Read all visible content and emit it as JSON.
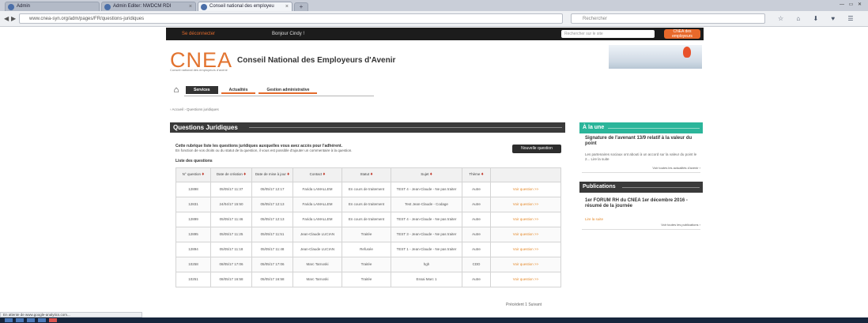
{
  "browser": {
    "tabs": [
      {
        "label": "Admin"
      },
      {
        "label": "Admin Editer: NWDCM RDI"
      },
      {
        "label": "Conseil national des employeu"
      }
    ],
    "new_tab": "+",
    "window_controls": "— ▭ ✕",
    "url": "www.cnea-syn.org/adm/pages/FR/questions-juridiques",
    "search_placeholder": "Rechercher",
    "back": "◀",
    "forward": "▶"
  },
  "site": {
    "top_left": "Se déconnecter",
    "greeting": "Bonjour Cindy !",
    "search_placeholder": "Rechercher sur le site",
    "top_logo": "CNEA des employeurs",
    "logo": "CNEA",
    "logo_sub": "Conseil national des employeurs d'avenir",
    "title": "Conseil National des Employeurs d'Avenir",
    "menu": {
      "home": "⌂",
      "items": [
        "Services",
        "Actualités",
        "Gestion administrative"
      ]
    },
    "breadcrumb": "› Accueil › Questions juridiques"
  },
  "main": {
    "heading": "Questions Juridiques",
    "intro_bold": "Cette rubrique liste les questions juridiques auxquelles vous avez accès pour l'adhérent.",
    "intro_text": "En fonction de vos droits ou du statut de la question, il vous est possible d'ajouter un commentaire à la question.",
    "new_question_button": "Nouvelle question",
    "list_label": "Liste des questions",
    "columns": [
      "N° question",
      "Date de création",
      "Date de mise à jour",
      "Contact",
      "Statut",
      "Sujet",
      "Thème",
      ""
    ],
    "rows": [
      {
        "num": "12898",
        "created": "05/05/17 11:37",
        "updated": "05/05/17 12:17",
        "contact": "Farida LAMALLEM",
        "status": "En cours de traitement",
        "subject": "TEST 4 - Jean-Claude - Ne pas traiter",
        "theme": "Autre",
        "action": "Voir question >>"
      },
      {
        "num": "12831",
        "created": "24/04/17 15:50",
        "updated": "05/05/17 12:13",
        "contact": "Farida LAMALLEM",
        "status": "En cours de traitement",
        "subject": "Test Jean-Claude - Codage",
        "theme": "Autre",
        "action": "Voir question >>"
      },
      {
        "num": "12899",
        "created": "05/05/17 11:46",
        "updated": "05/05/17 12:13",
        "contact": "Farida LAMALLEM",
        "status": "En cours de traitement",
        "subject": "TEST 4 - Jean-Claude - Ne pas traiter",
        "theme": "Autre",
        "action": "Voir question >>"
      },
      {
        "num": "12895",
        "created": "05/05/17 11:25",
        "updated": "05/05/17 11:51",
        "contact": "Jean-Claude LUCIAN",
        "status": "Traitée",
        "subject": "TEST 3 - Jean-Claude - Ne pas traiter",
        "theme": "Autre",
        "action": "Voir question >>"
      },
      {
        "num": "12894",
        "created": "05/05/17 11:18",
        "updated": "05/05/17 11:48",
        "contact": "Jean-Claude LUCIAN",
        "status": "Refusée",
        "subject": "TEST 1 - Jean-Claude - Ne pas traiter",
        "theme": "Autre",
        "action": "Voir question >>"
      },
      {
        "num": "10258",
        "created": "08/05/17 17:06",
        "updated": "05/05/17 17:06",
        "contact": "Marc Tarnoski",
        "status": "Traitée",
        "subject": "hgh",
        "theme": "CDD",
        "action": "Voir question >>"
      },
      {
        "num": "10251",
        "created": "08/05/17 16:58",
        "updated": "05/05/17 16:58",
        "contact": "Marc Tarnoski",
        "status": "Traitée",
        "subject": "Essai Marc 1",
        "theme": "Autre",
        "action": "Voir question >>"
      }
    ],
    "pager": "Précédent  1  Suivant"
  },
  "sidebar": {
    "news_heading": "À la une",
    "news_title": "Signature de l'avenant 13/9 relatif à la valeur du point",
    "news_text": "Les partenaires sociaux ont abouti à un accord sur la valeur du point le 2... Lire la suite",
    "news_more": "Voir toutes les actualités d'avenir ›",
    "pub_heading": "Publications",
    "pub_title": "1er FORUM RH du CNEA 1er décembre 2016 - résumé de la journée",
    "pub_link": "Lire la suite",
    "pub_more": "Voir toutes les publications ›"
  },
  "status_bar": "En attente de www.google-analytics.com..."
}
